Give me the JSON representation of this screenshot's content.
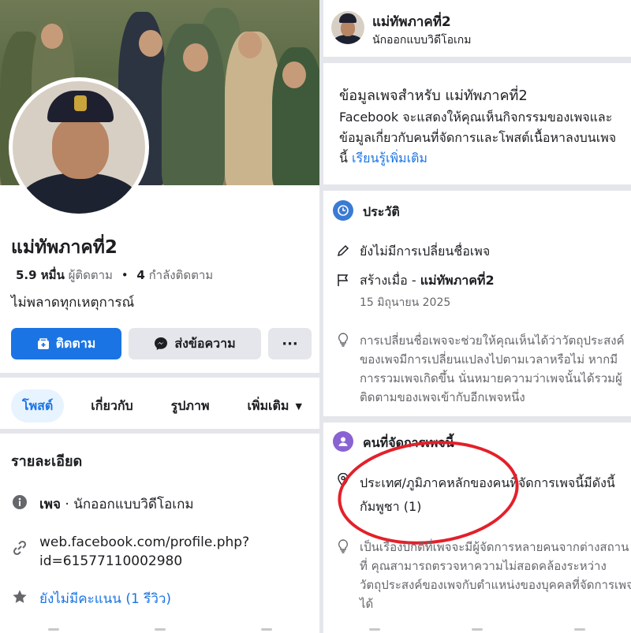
{
  "left": {
    "page_name": "แม่ทัพภาคที่2",
    "followers_count": "5.9 หมื่น",
    "followers_label": "ผู้ติดตาม",
    "following_count": "4",
    "following_label": "กำลังติดตาม",
    "stats_separator": "•",
    "tagline": "ไม่พลาดทุกเหตุการณ์",
    "buttons": {
      "follow": "ติดตาม",
      "message": "ส่งข้อความ",
      "more": "···"
    },
    "tabs": [
      {
        "label": "โพสต์"
      },
      {
        "label": "เกี่ยวกับ"
      },
      {
        "label": "รูปภาพ"
      },
      {
        "label": "เพิ่มเติม"
      }
    ],
    "details_title": "รายละเอียด",
    "details": {
      "page_label": "เพจ",
      "page_category": " · นักออกแบบวิดีโอเกม",
      "url_line1": "web.facebook.com/profile.php?",
      "url_line2": "id=61577110002980",
      "rating": "ยังไม่มีคะแนน (1 รีวิว)"
    }
  },
  "right": {
    "header_name": "แม่ทัพภาคที่2",
    "header_sub": "นักออกแบบวิดีโอเกม",
    "info_title": "ข้อมูลเพจสำหรับ แม่ทัพภาคที่2",
    "info_body": "Facebook จะแสดงให้คุณเห็นกิจกรรมของเพจและข้อมูลเกี่ยวกับคนที่จัดการและโพสต์เนื้อหาลงบนเพจนี้ ",
    "info_link": "เรียนรู้เพิ่มเติม",
    "history_title": "ประวัติ",
    "no_name_change": "ยังไม่มีการเปลี่ยนชื่อเพจ",
    "created_label": "สร้างเมื่อ - ",
    "created_name": "แม่ทัพภาคที่2",
    "created_date": "15 มิถุนายน 2025",
    "history_note": "การเปลี่ยนชื่อเพจจะช่วยให้คุณเห็นได้ว่าวัตถุประสงค์ของเพจมีการเปลี่ยนแปลงไปตามเวลาหรือไม่ หากมีการรวมเพจเกิดขึ้น นั่นหมายความว่าเพจนั้นได้รวมผู้ติดตามของเพจเข้ากับอีกเพจหนึ่ง",
    "managers_title": "คนที่จัดการเพจนี้",
    "managers_country_label": "ประเทศ/ภูมิภาคหลักของคนที่จัดการเพจนี้มีดังนี้",
    "managers_country": "กัมพูชา (1)",
    "managers_note": "เป็นเรื่องปกติที่เพจจะมีผู้จัดการหลายคนจากต่างสถานที่ คุณสามารถตรวจหาความไม่สอดคล้องระหว่างวัตถุประสงค์ของเพจกับตำแหน่งของบุคคลที่จัดการเพจได้"
  },
  "colors": {
    "brand_blue": "#1b74e4",
    "annotation_red": "#e3202a",
    "history_icon_bg": "#3a7bd5",
    "managers_icon_bg": "#8a63d2"
  }
}
